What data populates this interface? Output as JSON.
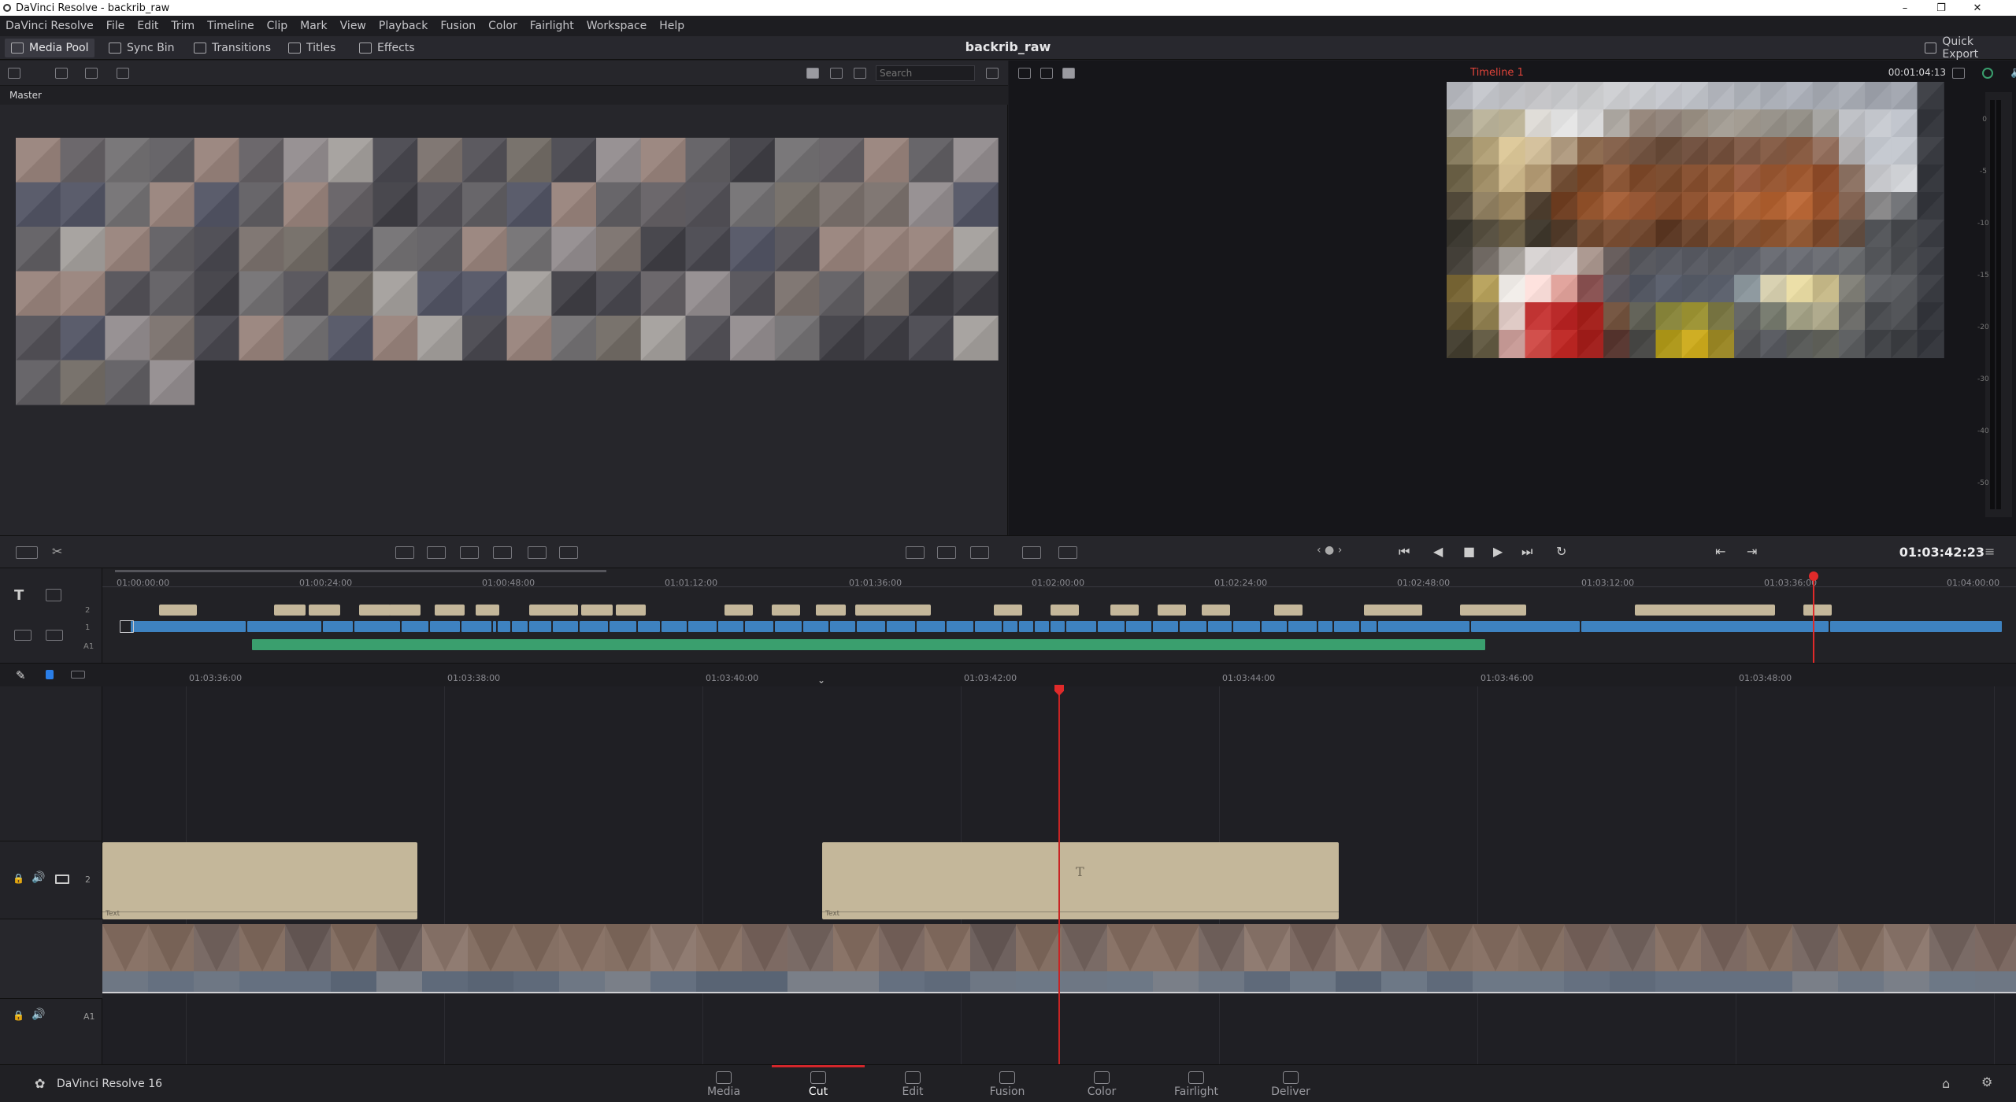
{
  "window": {
    "title": "DaVinci Resolve - backrib_raw",
    "minimize": "–",
    "maximize": "❐",
    "close": "✕"
  },
  "menu": [
    "DaVinci Resolve",
    "File",
    "Edit",
    "Trim",
    "Timeline",
    "Clip",
    "Mark",
    "View",
    "Playback",
    "Fusion",
    "Color",
    "Fairlight",
    "Workspace",
    "Help"
  ],
  "toolbar": {
    "media_pool": "Media Pool",
    "sync_bin": "Sync Bin",
    "transitions": "Transitions",
    "titles": "Titles",
    "effects": "Effects",
    "project_title": "backrib_raw",
    "quick_export": "Quick Export"
  },
  "media_pool": {
    "search_placeholder": "Search",
    "bin_name": "Master"
  },
  "viewer": {
    "timeline_name": "Timeline 1",
    "duration_tc": "00:01:04:13",
    "playhead_tc": "01:03:42:23",
    "audio_meter_scale": [
      "0",
      "-5",
      "-10",
      "-15",
      "-20",
      "-30",
      "-40",
      "-50"
    ]
  },
  "overview_ruler": [
    "01:00:00:00",
    "01:00:24:00",
    "01:00:48:00",
    "01:01:12:00",
    "01:01:36:00",
    "01:02:00:00",
    "01:02:24:00",
    "01:02:48:00",
    "01:03:12:00",
    "01:03:36:00",
    "01:04:00:00"
  ],
  "overview_tracks": [
    "2",
    "1",
    "A1"
  ],
  "detail_ruler": [
    "01:03:36:00",
    "01:03:38:00",
    "01:03:40:00",
    "01:03:42:00",
    "01:03:44:00",
    "01:03:46:00",
    "01:03:48:00"
  ],
  "detail_tracks": {
    "v2": "2",
    "a1": "A1"
  },
  "text_clips": [
    {
      "label": "Text"
    },
    {
      "label": "Text",
      "glyph": "T"
    }
  ],
  "brand": "DaVinci Resolve 16",
  "pages": [
    {
      "label": "Media",
      "key": "media"
    },
    {
      "label": "Cut",
      "key": "cut"
    },
    {
      "label": "Edit",
      "key": "edit"
    },
    {
      "label": "Fusion",
      "key": "fusion"
    },
    {
      "label": "Color",
      "key": "color"
    },
    {
      "label": "Fairlight",
      "key": "fairlight"
    },
    {
      "label": "Deliver",
      "key": "deliver"
    }
  ],
  "active_page": "cut",
  "colors": {
    "accent_red": "#d3262b",
    "title_clip": "#c4b79a",
    "video_clip": "#3e82c0",
    "audio_clip": "#3a9f6e",
    "playhead": "#e02a2a",
    "timeline_label": "#e0443a"
  }
}
